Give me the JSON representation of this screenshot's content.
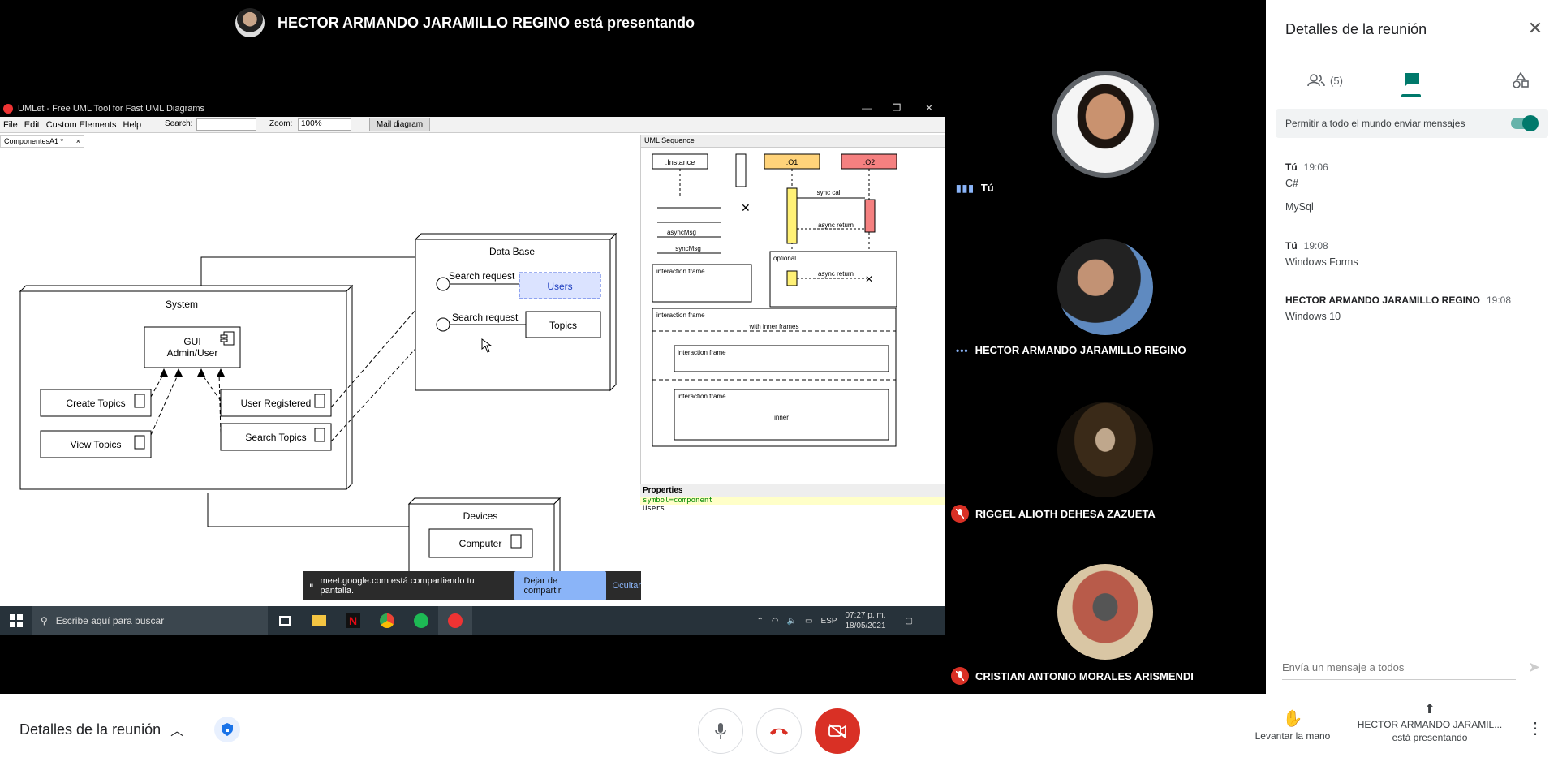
{
  "presenter": {
    "banner": "HECTOR ARMANDO JARAMILLO REGINO está presentando"
  },
  "shared_screen": {
    "window_title": "UMLet - Free UML Tool for Fast UML Diagrams",
    "menu": [
      "File",
      "Edit",
      "Custom Elements",
      "Help"
    ],
    "search_label": "Search:",
    "zoom_label": "Zoom:",
    "zoom_value": "100%",
    "mail_button": "Mail diagram",
    "doc_tab": "ComponentesA1 *",
    "palette_title": "UML Sequence",
    "diagram": {
      "system_title": "System",
      "gui_line1": "GUI",
      "gui_line2": "Admin/User",
      "create_topics": "Create Topics",
      "view_topics": "View Topics",
      "user_registered": "User Registered",
      "search_topics": "Search Topics",
      "db_title": "Data Base",
      "search_request_1": "Search request",
      "search_request_2": "Search request",
      "users": "Users",
      "topics": "Topics",
      "devices_title": "Devices",
      "computer": "Computer"
    },
    "sequence_palette": {
      "instance": ":Instance",
      "o1": ":O1",
      "o2": ":O2",
      "sync_call": "sync call",
      "async_return_1": "async return",
      "async_msg": "asyncMsg",
      "sync_msg": "syncMsg",
      "interaction_frame": "interaction frame",
      "optional": "optional",
      "async_return_2": "async return",
      "with_inner_frames": "with inner frames",
      "inner": "inner"
    },
    "properties": {
      "title": "Properties",
      "line1": "symbol=component",
      "line2": "Users"
    },
    "share_notice": {
      "text": "meet.google.com está compartiendo tu pantalla.",
      "stop_button": "Dejar de compartir",
      "hide_link": "Ocultar"
    },
    "taskbar": {
      "search_placeholder": "Escribe aquí para buscar",
      "lang": "ESP",
      "time": "07:27 p. m.",
      "date": "18/05/2021"
    }
  },
  "participants": [
    {
      "name": "Tú",
      "mic": "speaking"
    },
    {
      "name": "HECTOR ARMANDO JARAMILLO REGINO",
      "mic": "presenting"
    },
    {
      "name": "RIGGEL ALIOTH DEHESA ZAZUETA",
      "mic": "muted"
    },
    {
      "name": "CRISTIAN ANTONIO MORALES ARISMENDI",
      "mic": "muted"
    }
  ],
  "side_panel": {
    "title": "Detalles de la reunión",
    "people_count": "(5)",
    "allow_messages": "Permitir a todo el mundo enviar mensajes",
    "messages": [
      {
        "sender": "Tú",
        "time": "19:06",
        "lines": [
          "C#",
          "MySql"
        ]
      },
      {
        "sender": "Tú",
        "time": "19:08",
        "lines": [
          "Windows Forms"
        ]
      },
      {
        "sender": "HECTOR ARMANDO JARAMILLO REGINO",
        "time": "19:08",
        "lines": [
          "Windows 10"
        ]
      }
    ],
    "input_placeholder": "Envía un mensaje a todos"
  },
  "bottom_bar": {
    "meeting_details": "Detalles de la reunión",
    "raise_hand": "Levantar la mano",
    "presenting_line1": "HECTOR ARMANDO JARAMIL...",
    "presenting_line2": "está presentando"
  },
  "colors": {
    "accent": "#00796b",
    "danger": "#d93025",
    "link": "#8ab4f8"
  }
}
